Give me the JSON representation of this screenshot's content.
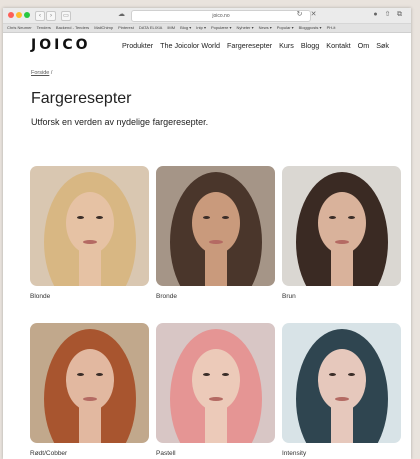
{
  "browser": {
    "url": "joico.no",
    "favorites": [
      "Chris Neumer",
      "Tenders",
      "Backend - Tenders",
      "MailChimp",
      "Pinterest",
      "DATA ELIXIA",
      "IMM",
      "Blog ▾",
      "Intp ▾",
      "Populære ▾",
      "Nyheter ▾",
      "News ▾",
      "Popular ▾",
      "Bloggposts ▾",
      "PH-it"
    ]
  },
  "site": {
    "logo": "JOICO",
    "nav": [
      "Produkter",
      "The Joicolor World",
      "Fargeresepter",
      "Kurs",
      "Blogg",
      "Kontakt",
      "Om",
      "Søk"
    ]
  },
  "breadcrumb": {
    "home": "Forside",
    "separator": "/"
  },
  "page": {
    "title": "Fargeresepter",
    "subtitle": "Utforsk en verden av nydelige fargeresepter."
  },
  "categories": [
    {
      "label": "Blonde",
      "bg": "#d9c7b1",
      "hair": "#d8b783",
      "skin": "#e6c2a4"
    },
    {
      "label": "Bronde",
      "bg": "#a59587",
      "hair": "#4a362b",
      "skin": "#c99a7c"
    },
    {
      "label": "Brun",
      "bg": "#dad7d2",
      "hair": "#3a2a23",
      "skin": "#d9b29b"
    },
    {
      "label": "Rødt/Cobber",
      "bg": "#c1a88c",
      "hair": "#a8552f",
      "skin": "#e2b8a0"
    },
    {
      "label": "Pastell",
      "bg": "#d8c6c5",
      "hair": "#e59594",
      "skin": "#eccab9"
    },
    {
      "label": "Intensity",
      "bg": "#d8e3e7",
      "hair": "#2f4550",
      "skin": "#e6c8bc"
    }
  ]
}
